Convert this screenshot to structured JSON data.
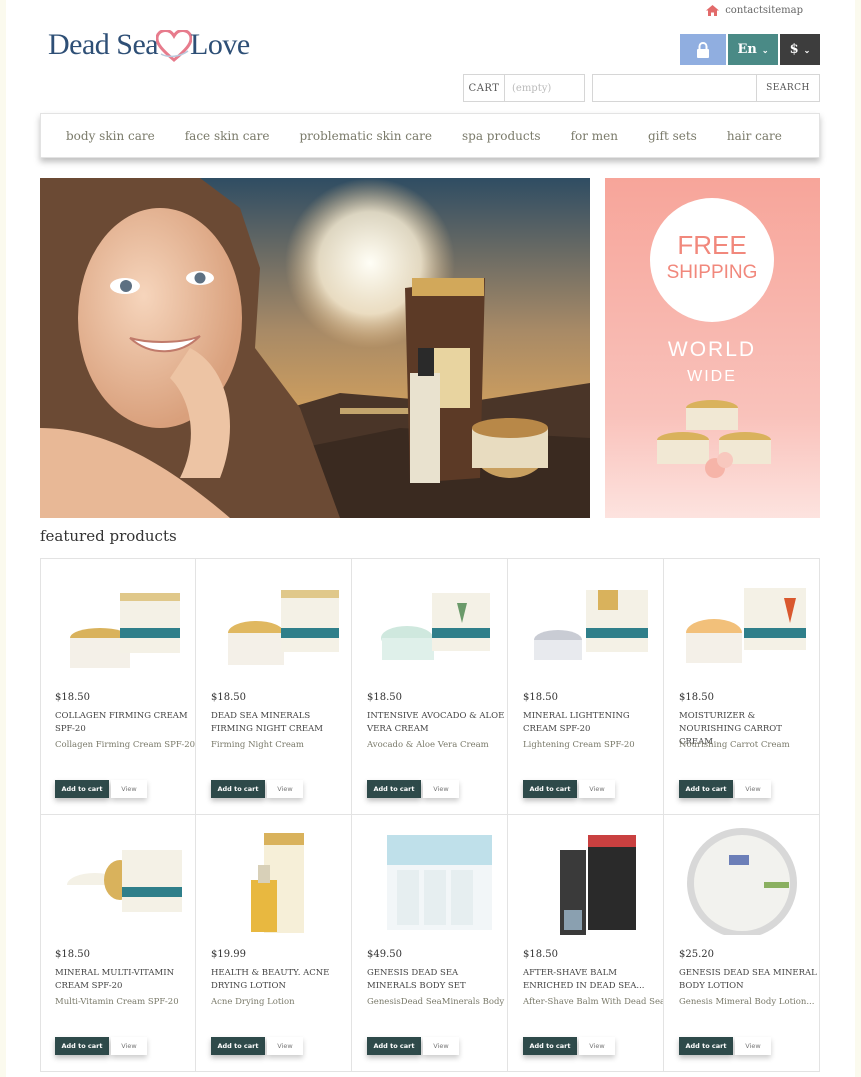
{
  "header": {
    "contact": "contact",
    "sitemap": "sitemap",
    "logo_part1": "Dead Sea",
    "logo_part2": "Love",
    "lang": "En",
    "currency": "$",
    "cart_label": "CART",
    "cart_value": "(empty)",
    "search_placeholder": "",
    "search_button": "SEARCH"
  },
  "nav": {
    "items": [
      "body skin care",
      "face skin care",
      "problematic skin care",
      "spa products",
      "for men",
      "gift sets",
      "hair care"
    ]
  },
  "promo": {
    "line1": "FREE",
    "line2": "SHIPPING",
    "line3": "WORLD",
    "line4": "WIDE"
  },
  "featured": {
    "title": "featured products",
    "add_label": "Add to cart",
    "view_label": "View",
    "products": [
      {
        "price": "$18.50",
        "name": "COLLAGEN FIRMING CREAM SPF-20",
        "desc": "Collagen Firming Cream SPF-20"
      },
      {
        "price": "$18.50",
        "name": "DEAD SEA MINERALS FIRMING NIGHT CREAM",
        "desc": "Firming Night Cream"
      },
      {
        "price": "$18.50",
        "name": "INTENSIVE AVOCADO & ALOE VERA CREAM",
        "desc": "Avocado & Aloe Vera Cream"
      },
      {
        "price": "$18.50",
        "name": "MINERAL LIGHTENING CREAM SPF-20",
        "desc": "Lightening Cream SPF-20"
      },
      {
        "price": "$18.50",
        "name": "MOISTURIZER & NOURISHING CARROT CREAM",
        "desc": " Nourishing Carrot Cream"
      },
      {
        "price": "$18.50",
        "name": "MINERAL MULTI-VITAMIN CREAM SPF-20",
        "desc": "Multi-Vitamin Cream SPF-20"
      },
      {
        "price": "$19.99",
        "name": "HEALTH & BEAUTY. ACNE DRYING LOTION",
        "desc": "Acne Drying Lotion"
      },
      {
        "price": "$49.50",
        "name": "GENESIS DEAD SEA MINERALS BODY SET",
        "desc": "GenesisDead SeaMinerals Body Set"
      },
      {
        "price": "$18.50",
        "name": "AFTER-SHAVE BALM ENRICHED IN DEAD SEA...",
        "desc": "After-Shave Balm With Dead Sea..."
      },
      {
        "price": "$25.20",
        "name": "GENESIS DEAD SEA MINERAL BODY LOTION",
        "desc": "Genesis Mimeral Body Lotion..."
      }
    ]
  },
  "colors": {
    "accent_teal": "#2e4a4a",
    "lang_button": "#4a8a86",
    "lock_button": "#90aee0",
    "logo_blue": "#2e4f76",
    "promo_pink": "#f7a9a0"
  }
}
